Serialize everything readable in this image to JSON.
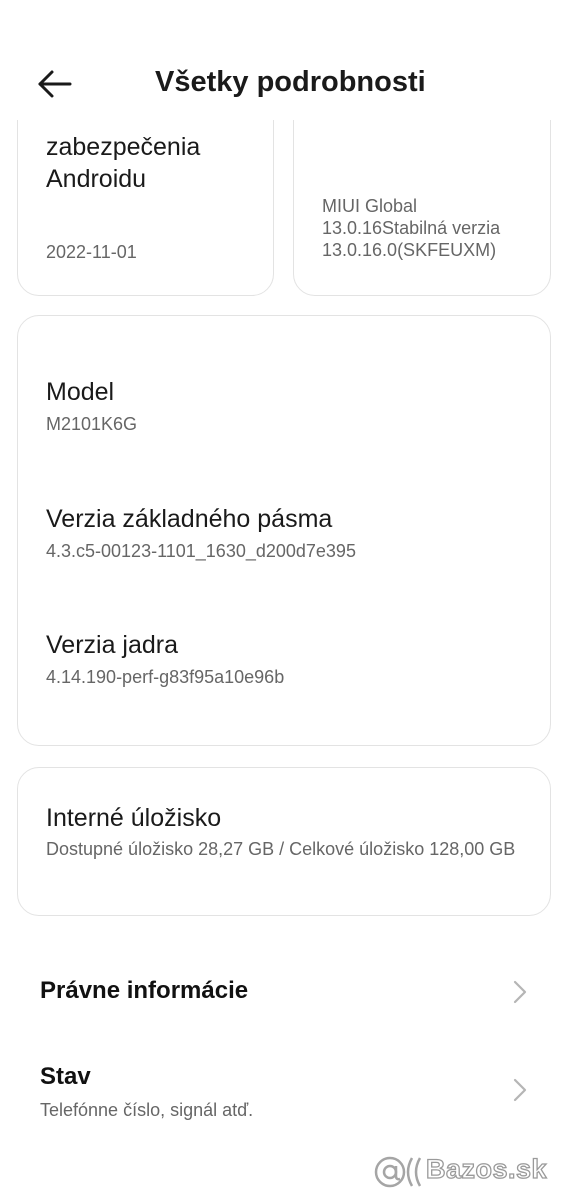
{
  "header": {
    "title": "Všetky podrobnosti",
    "back_icon": "arrow-left-icon"
  },
  "top_cards": {
    "left": {
      "title_line1": "zabezpečenia",
      "title_line2": "Androidu",
      "value": "2022-11-01"
    },
    "right": {
      "version_line1": "MIUI Global",
      "version_line2": "13.0.16Stabilná verzia",
      "version_line3": "13.0.16.0(SKFEUXM)"
    }
  },
  "device_card": {
    "items": [
      {
        "label": "Model",
        "value": "M2101K6G"
      },
      {
        "label": "Verzia základného pásma",
        "value": "4.3.c5-00123-1101_1630_d200d7e395"
      },
      {
        "label": "Verzia jadra",
        "value": "4.14.190-perf-g83f95a10e96b"
      }
    ]
  },
  "storage_card": {
    "label": "Interné úložisko",
    "value": "Dostupné úložisko  28,27 GB / Celkové úložisko 128,00 GB"
  },
  "list": {
    "legal": {
      "title": "Právne informácie"
    },
    "status": {
      "title": "Stav",
      "subtitle": "Telefónne číslo, signál atď."
    }
  },
  "watermark": {
    "text": "Bazos.sk"
  },
  "colors": {
    "background": "#ffffff",
    "card_border": "#e3e3e3",
    "secondary_text": "#666666"
  }
}
